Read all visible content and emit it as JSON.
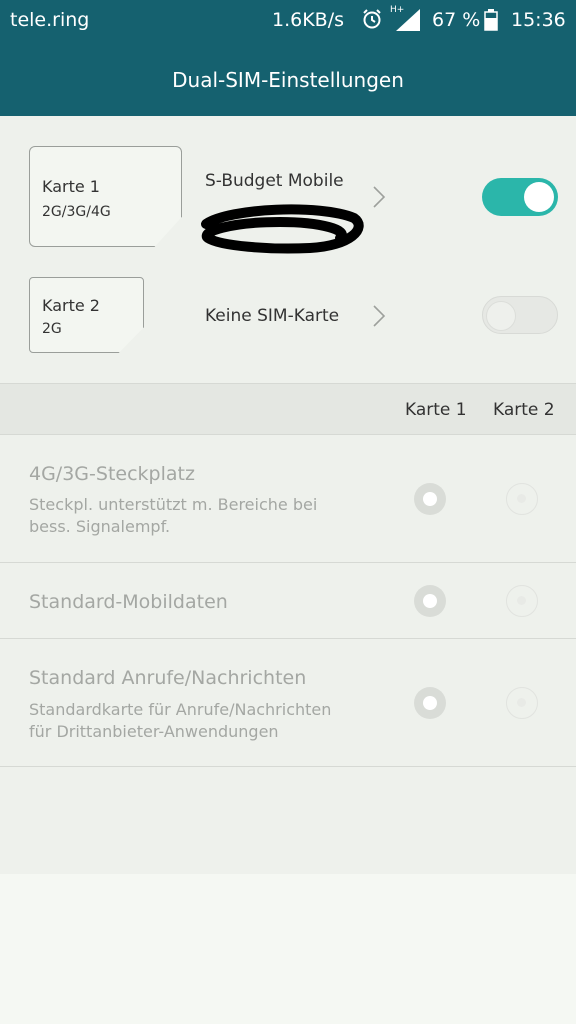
{
  "status_bar": {
    "carrier": "tele.ring",
    "speed": "1.6KB/s",
    "network_type": "H+",
    "battery_percent": "67 %",
    "time": "15:36",
    "icons": [
      "alarm-icon",
      "signal-icon",
      "battery-icon"
    ]
  },
  "header": {
    "title": "Dual-SIM-Einstellungen"
  },
  "sims": [
    {
      "card_name": "Karte 1",
      "card_tech": "2G/3G/4G",
      "operator": "S-Budget Mobile",
      "enabled": true
    },
    {
      "card_name": "Karte 2",
      "card_tech": "2G",
      "operator": "Keine SIM-Karte",
      "enabled": false
    }
  ],
  "columns": {
    "card1": "Karte 1",
    "card2": "Karte 2"
  },
  "settings": [
    {
      "title": "4G/3G-Steckplatz",
      "desc_line1": "Steckpl. unterstützt m. Bereiche bei",
      "desc_line2": "bess. Signalempf.",
      "selected": "Karte 1"
    },
    {
      "title": "Standard-Mobildaten",
      "selected": "Karte 1"
    },
    {
      "title": "Standard Anrufe/Nachrichten",
      "desc_line1": "Standardkarte für Anrufe/Nachrichten",
      "desc_line2": "für Drittanbieter-Anwendungen",
      "selected": "Karte 1"
    }
  ],
  "colors": {
    "header_bg": "#15616f",
    "toggle_on": "#2bb6aa",
    "panel_bg": "#eef1ec"
  }
}
